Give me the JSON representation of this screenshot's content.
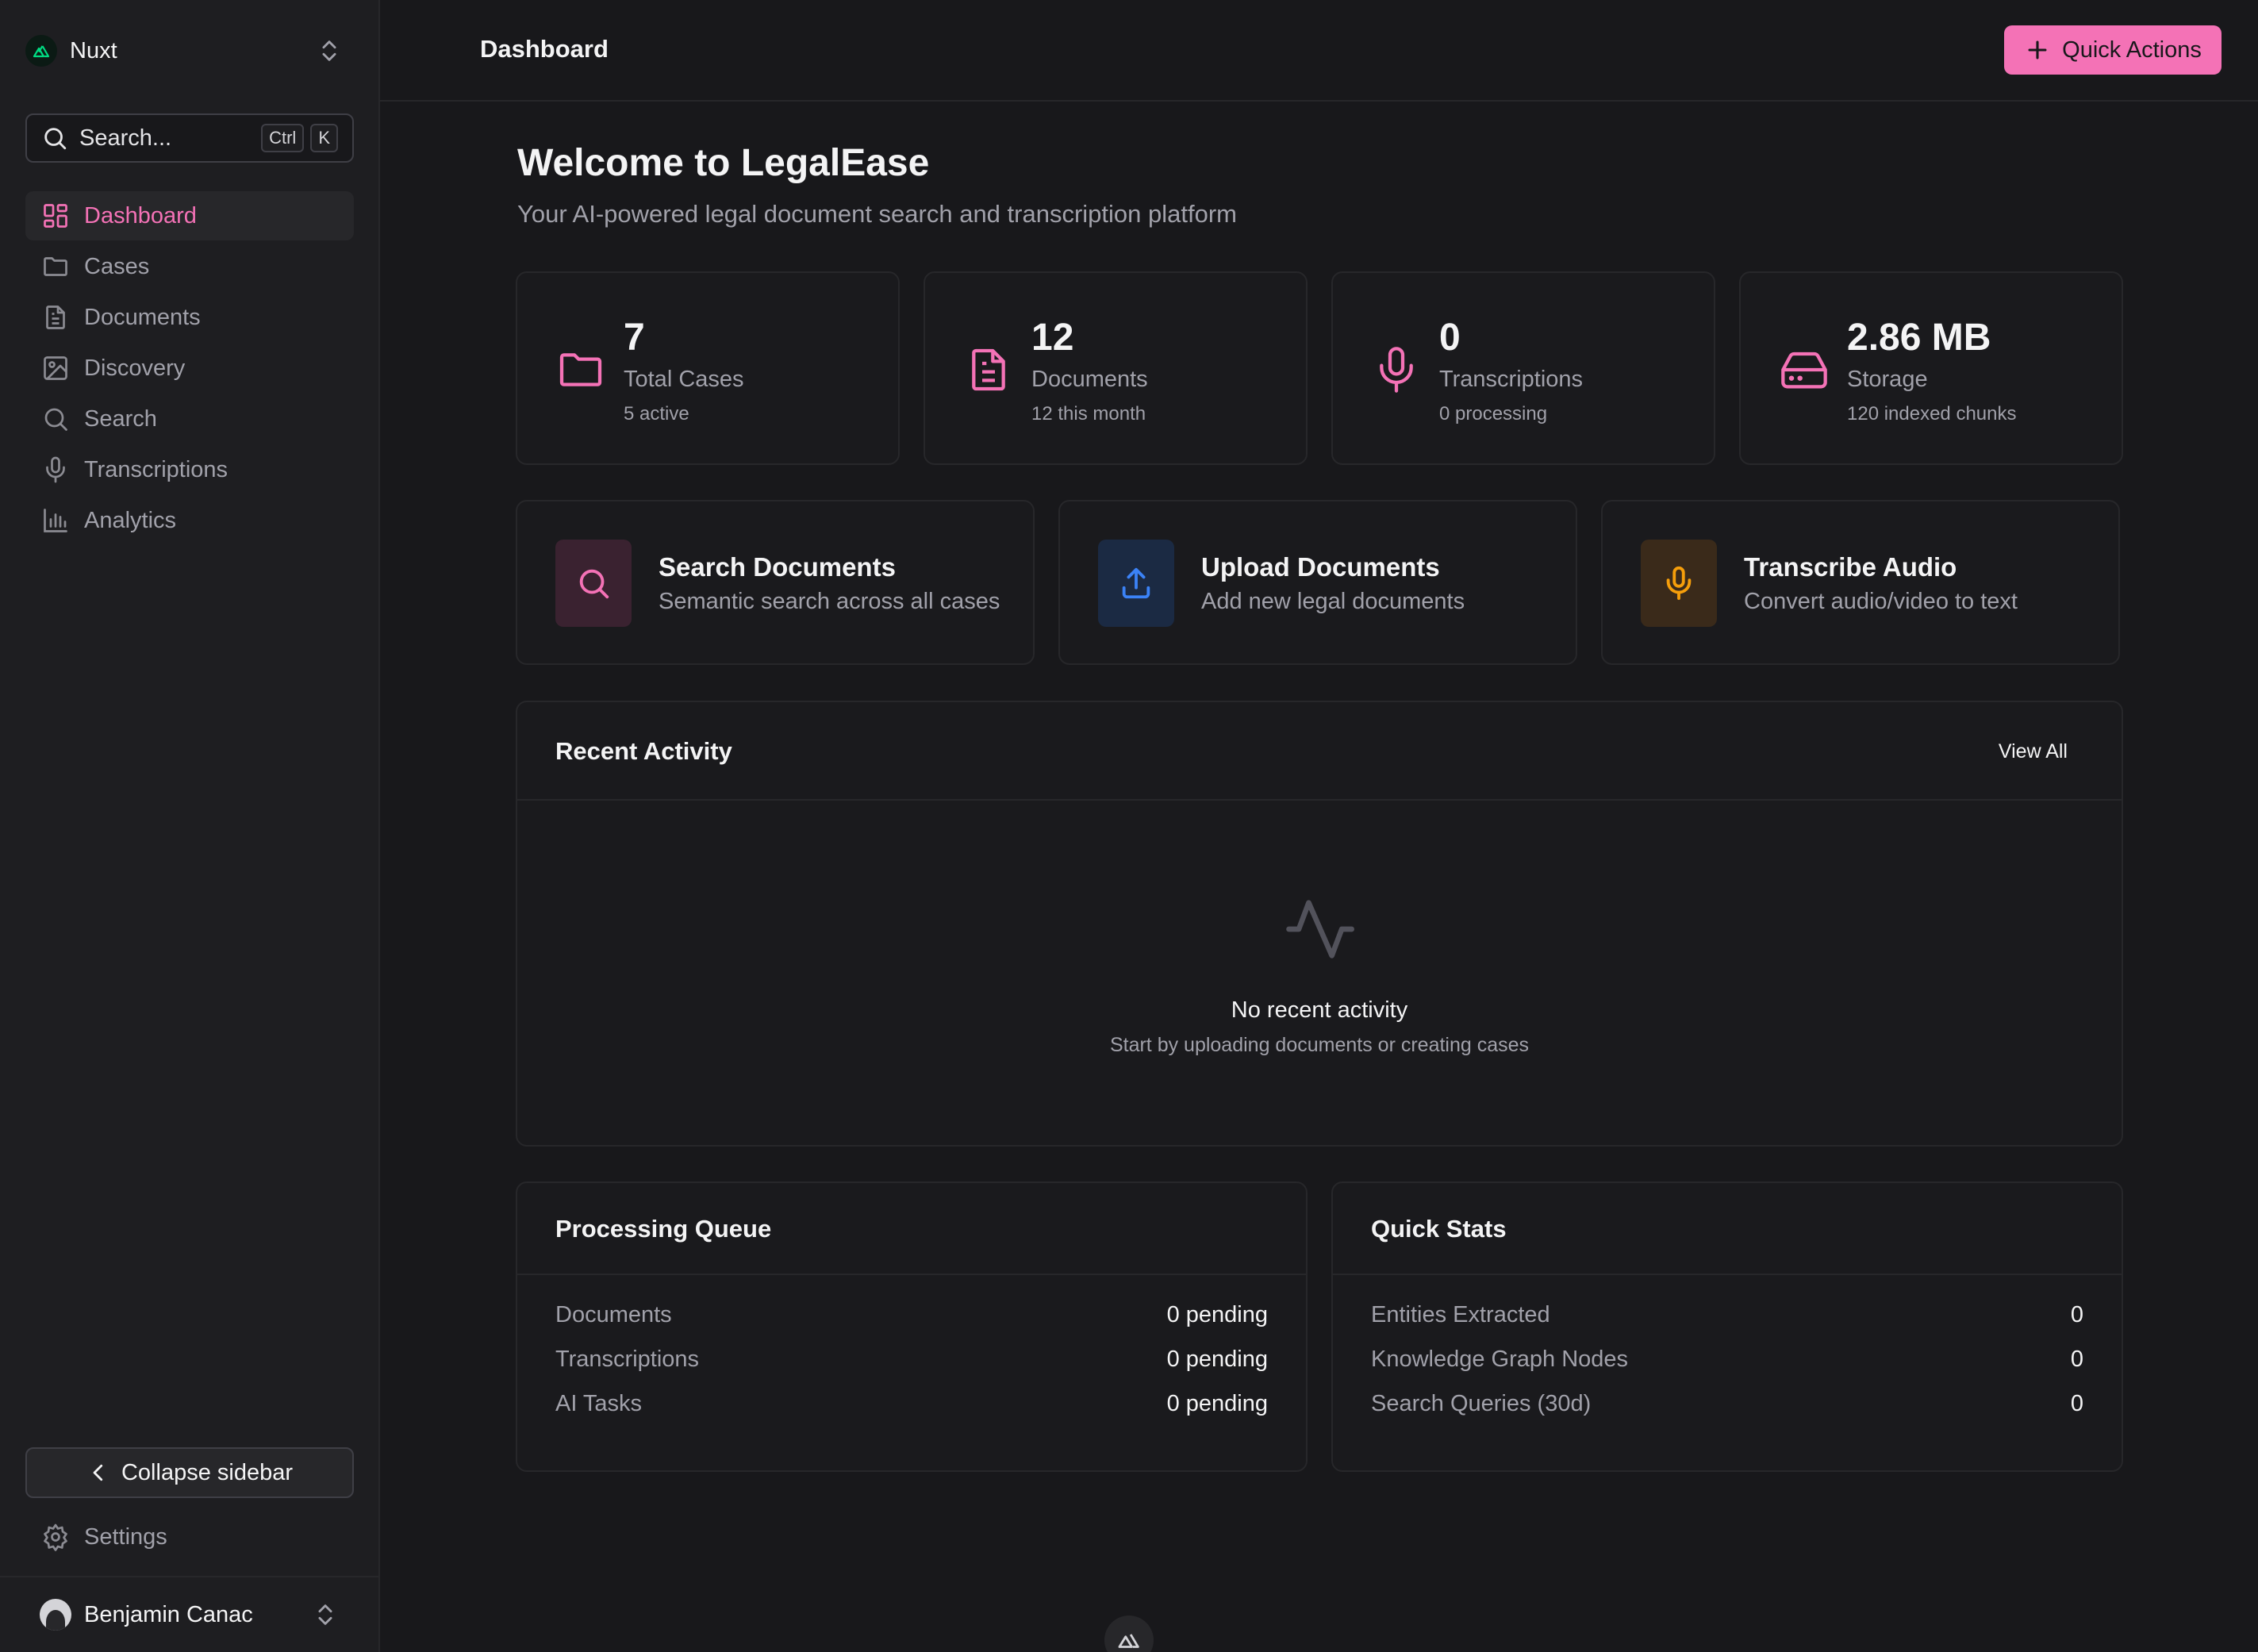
{
  "sidebar": {
    "brand": {
      "name": "Nuxt"
    },
    "search": {
      "placeholder": "Search...",
      "kbd": [
        "Ctrl",
        "K"
      ]
    },
    "items": [
      {
        "label": "Dashboard",
        "icon": "layout-grid-icon",
        "active": true
      },
      {
        "label": "Cases",
        "icon": "folder-icon"
      },
      {
        "label": "Documents",
        "icon": "file-text-icon"
      },
      {
        "label": "Discovery",
        "icon": "image-icon"
      },
      {
        "label": "Search",
        "icon": "search-icon"
      },
      {
        "label": "Transcriptions",
        "icon": "microphone-icon"
      },
      {
        "label": "Analytics",
        "icon": "bar-chart-icon"
      }
    ],
    "collapse_label": "Collapse sidebar",
    "settings_label": "Settings",
    "user": {
      "name": "Benjamin Canac"
    }
  },
  "header": {
    "title": "Dashboard",
    "quick_actions_label": "Quick Actions"
  },
  "welcome": {
    "title": "Welcome to LegalEase",
    "subtitle": "Your AI-powered legal document search and transcription platform"
  },
  "stats": [
    {
      "value": "7",
      "label": "Total Cases",
      "sub": "5 active",
      "icon": "folder-icon"
    },
    {
      "value": "12",
      "label": "Documents",
      "sub": "12 this month",
      "icon": "file-text-icon"
    },
    {
      "value": "0",
      "label": "Transcriptions",
      "sub": "0 processing",
      "icon": "microphone-icon"
    },
    {
      "value": "2.86 MB",
      "label": "Storage",
      "sub": "120 indexed chunks",
      "icon": "hard-drive-icon"
    }
  ],
  "actions": [
    {
      "title": "Search Documents",
      "subtitle": "Semantic search across all cases",
      "icon": "search-icon",
      "color": "#f472b6"
    },
    {
      "title": "Upload Documents",
      "subtitle": "Add new legal documents",
      "icon": "upload-icon",
      "color": "#3b82f6"
    },
    {
      "title": "Transcribe Audio",
      "subtitle": "Convert audio/video to text",
      "icon": "microphone-icon",
      "color": "#f59e0b"
    }
  ],
  "activity": {
    "title": "Recent Activity",
    "view_all": "View All",
    "empty_title": "No recent activity",
    "empty_subtitle": "Start by uploading documents or creating cases"
  },
  "processing_queue": {
    "title": "Processing Queue",
    "rows": [
      {
        "label": "Documents",
        "value": "0 pending"
      },
      {
        "label": "Transcriptions",
        "value": "0 pending"
      },
      {
        "label": "AI Tasks",
        "value": "0 pending"
      }
    ]
  },
  "quick_stats": {
    "title": "Quick Stats",
    "rows": [
      {
        "label": "Entities Extracted",
        "value": "0"
      },
      {
        "label": "Knowledge Graph Nodes",
        "value": "0"
      },
      {
        "label": "Search Queries (30d)",
        "value": "0"
      }
    ]
  },
  "colors": {
    "accent": "#f472b6",
    "background": "#18181b",
    "sidebar": "#1e1e21",
    "border": "#27272a"
  }
}
